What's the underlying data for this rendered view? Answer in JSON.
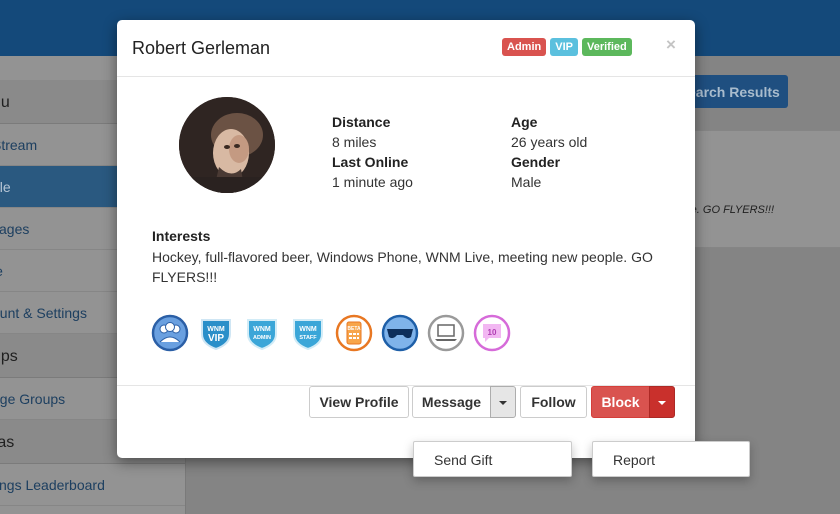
{
  "background": {
    "sidebar": {
      "head1": "nu",
      "items1": [
        "Stream",
        "ple",
        "sages",
        "le",
        "ount & Settings"
      ],
      "head2": "ups",
      "items2": [
        "age Groups"
      ],
      "head3": "ras",
      "items3": [
        "tings Leaderboard"
      ]
    },
    "search_button": "earch Results",
    "italic_text": "ople. GO FLYERS!!!"
  },
  "modal": {
    "title": "Robert Gerleman",
    "badges": [
      {
        "label": "Admin",
        "color": "#d9534f"
      },
      {
        "label": "VIP",
        "color": "#5bc0de"
      },
      {
        "label": "Verified",
        "color": "#5cb85c"
      }
    ],
    "close": "×",
    "fields": {
      "distance_label": "Distance",
      "distance_value": "8 miles",
      "age_label": "Age",
      "age_value": "26 years old",
      "last_online_label": "Last Online",
      "last_online_value": "1 minute ago",
      "gender_label": "Gender",
      "gender_value": "Male"
    },
    "interests_label": "Interests",
    "interests_value": "Hockey, full-flavored beer, Windows Phone, WNM Live, meeting new people. GO FLYERS!!!",
    "achievements": [
      {
        "icon": "group-icon",
        "color": "#2b6cb3"
      },
      {
        "icon": "wnm-vip-shield-icon",
        "text": [
          "WNM",
          "VIP"
        ],
        "color": "#2a8fc9"
      },
      {
        "icon": "wnm-admin-shield-icon",
        "text": [
          "WNM",
          "ADMIN"
        ],
        "color": "#3ba6d8"
      },
      {
        "icon": "wnm-staff-shield-icon",
        "text": [
          "WNM",
          "STAFF"
        ],
        "color": "#3ba6d8"
      },
      {
        "icon": "beta-phone-icon",
        "text": [
          "BETA"
        ],
        "color": "#e87722"
      },
      {
        "icon": "sunglasses-icon",
        "color": "#1e6fc4"
      },
      {
        "icon": "laptop-icon",
        "color": "#9a9a9a"
      },
      {
        "icon": "ten-messages-icon",
        "text": [
          "10"
        ],
        "color": "#d66bd9"
      }
    ],
    "buttons": {
      "view_profile": "View Profile",
      "message": "Message",
      "follow": "Follow",
      "block": "Block"
    },
    "message_menu": [
      "Send Gift"
    ],
    "block_menu": [
      "Report"
    ]
  }
}
